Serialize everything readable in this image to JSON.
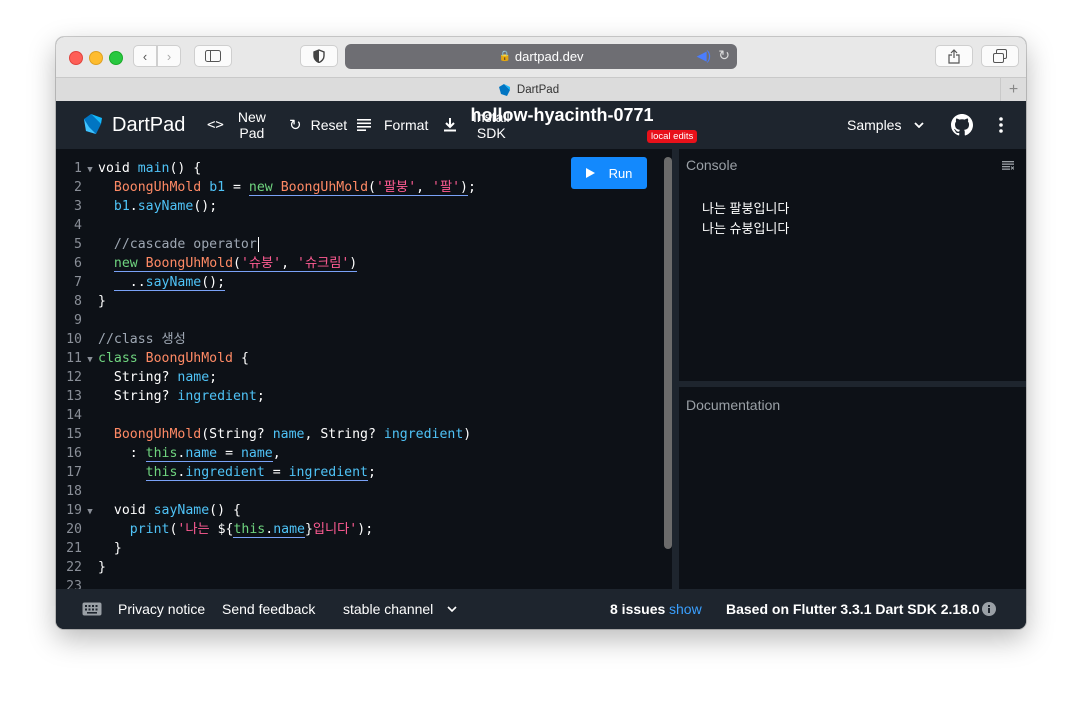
{
  "browser": {
    "url": "dartpad.dev",
    "tab_title": "DartPad"
  },
  "header": {
    "logo_text": "DartPad",
    "new_pad_line1": "New",
    "new_pad_line2": "Pad",
    "reset": "Reset",
    "format": "Format",
    "install_line1": "Install",
    "install_line2": "SDK",
    "title": "hollow-hyacinth-0771",
    "badge": "local edits",
    "samples": "Samples"
  },
  "editor": {
    "run_label": "Run",
    "line_numbers": [
      "1",
      "2",
      "3",
      "4",
      "5",
      "6",
      "7",
      "8",
      "9",
      "10",
      "11",
      "12",
      "13",
      "14",
      "15",
      "16",
      "17",
      "18",
      "19",
      "20",
      "21",
      "22",
      "23"
    ]
  },
  "console": {
    "title": "Console",
    "lines": [
      "나는 팔붕입니다",
      "나는 슈붕입니다"
    ]
  },
  "documentation": {
    "title": "Documentation"
  },
  "footer": {
    "privacy": "Privacy notice",
    "feedback": "Send feedback",
    "channel": "stable channel",
    "issues": "8 issues",
    "show": "show",
    "version": "Based on Flutter 3.3.1 Dart SDK 2.18.0"
  },
  "colors": {
    "run_button": "#1389fd",
    "badge": "#e8111a",
    "show_link": "#3aa0ff"
  }
}
